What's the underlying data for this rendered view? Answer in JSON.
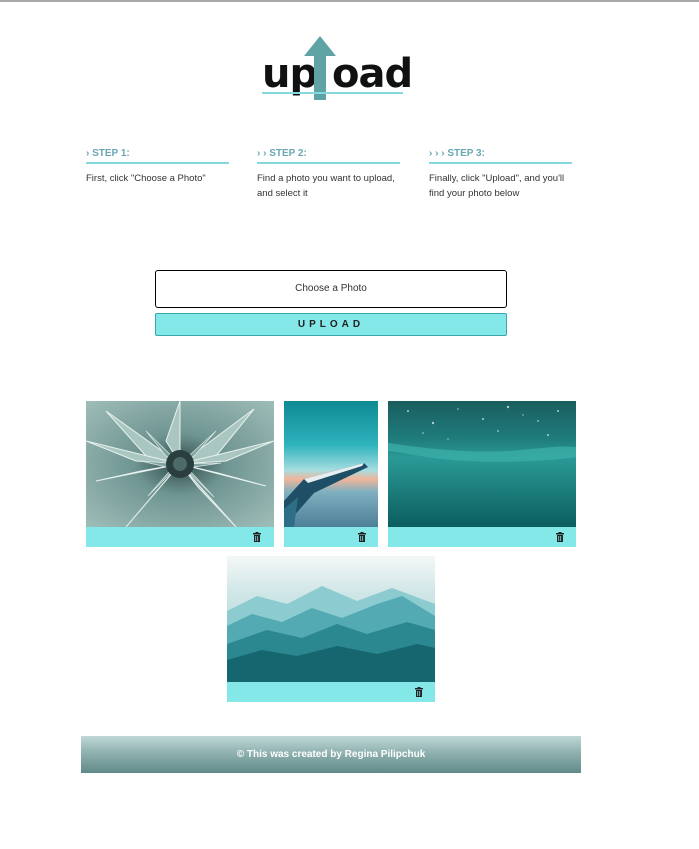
{
  "logo": {
    "text_left": "up",
    "text_right": "oad",
    "arrow_color": "#5fa3a5",
    "icon": "upload-arrow-icon"
  },
  "steps": [
    {
      "title": "› STEP 1:",
      "description": "First, click \"Choose a Photo\""
    },
    {
      "title": "› › STEP 2:",
      "description": "Find a photo you want to upload, and select it"
    },
    {
      "title": "› › › STEP 3:",
      "description": "Finally, click \"Upload\", and you'll find your photo below"
    }
  ],
  "upload_form": {
    "choose_label": "Choose a Photo",
    "upload_label": "UPLOAD"
  },
  "gallery": {
    "accent_color": "#85e8e8",
    "photos": [
      {
        "subject": "succulent-agave",
        "delete_icon": "trash-icon"
      },
      {
        "subject": "airplane-wing-sky",
        "delete_icon": "trash-icon"
      },
      {
        "subject": "underwater-ocean",
        "delete_icon": "trash-icon"
      },
      {
        "subject": "misty-mountains",
        "delete_icon": "trash-icon"
      }
    ]
  },
  "footer": {
    "text": "© This was created by Regina Pilipchuk"
  }
}
